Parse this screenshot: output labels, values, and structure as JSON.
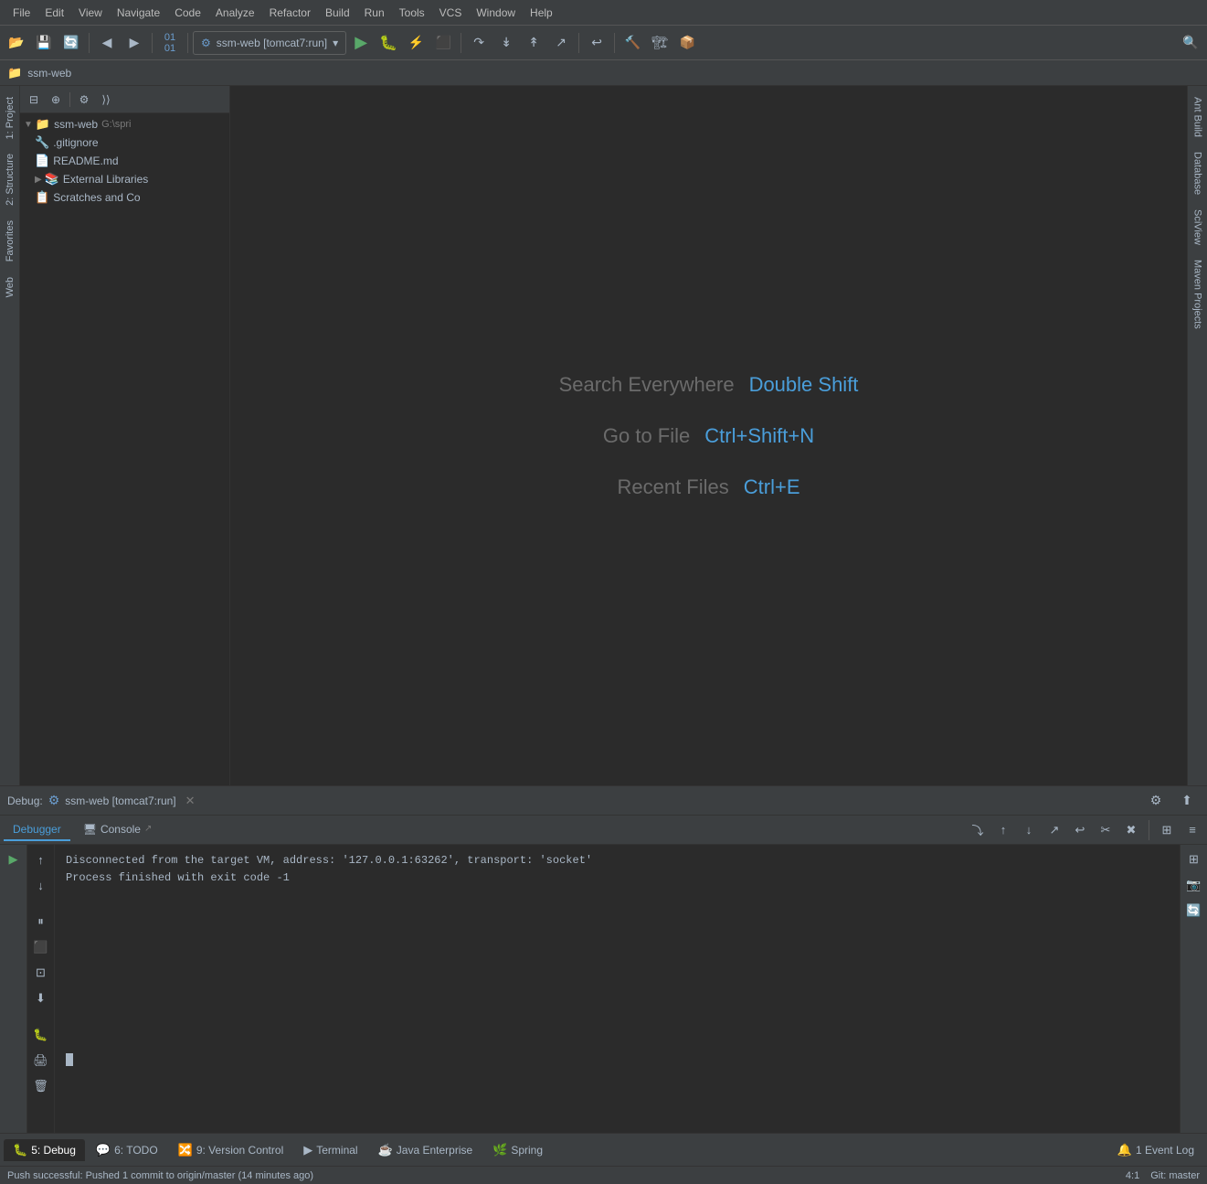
{
  "menubar": {
    "items": [
      "File",
      "Edit",
      "View",
      "Navigate",
      "Code",
      "Analyze",
      "Refactor",
      "Build",
      "Run",
      "Tools",
      "VCS",
      "Window",
      "Help"
    ]
  },
  "toolbar": {
    "run_config": "ssm-web [tomcat7:run]",
    "run_config_icon": "⚙"
  },
  "project_header": {
    "name": "ssm-web"
  },
  "project_panel": {
    "title": "1: Project",
    "tree": [
      {
        "label": "ssm-web",
        "suffix": "G:\\spri",
        "level": 0,
        "type": "folder",
        "expanded": true
      },
      {
        "label": ".gitignore",
        "level": 1,
        "type": "git"
      },
      {
        "label": "README.md",
        "level": 1,
        "type": "md"
      },
      {
        "label": "External Libraries",
        "level": 1,
        "type": "lib",
        "expandable": true
      },
      {
        "label": "Scratches and Co",
        "level": 1,
        "type": "scratch"
      }
    ]
  },
  "editor": {
    "shortcuts": [
      {
        "label": "Search Everywhere",
        "key": "Double Shift"
      },
      {
        "label": "Go to File",
        "key": "Ctrl+Shift+N"
      },
      {
        "label": "Recent Files",
        "key": "Ctrl+E"
      }
    ]
  },
  "right_sidebar": {
    "panels": [
      "Ant Build",
      "Database",
      "SciView",
      "Maven Projects"
    ]
  },
  "debug_panel": {
    "title": "Debug:",
    "run_config": "ssm-web [tomcat7:run]",
    "tabs": [
      {
        "label": "Debugger",
        "active": false
      },
      {
        "label": "Console",
        "active": true
      }
    ],
    "console_lines": [
      "Disconnected from the target VM, address: '127.0.0.1:63262', transport: 'socket'",
      "",
      "Process finished with exit code -1"
    ]
  },
  "bottom_tabs": [
    {
      "label": "5: Debug",
      "icon": "🐛",
      "active": true
    },
    {
      "label": "6: TODO",
      "icon": "💬",
      "active": false
    },
    {
      "label": "9: Version Control",
      "icon": "🔀",
      "active": false
    },
    {
      "label": "Terminal",
      "icon": "▶",
      "active": false
    },
    {
      "label": "Java Enterprise",
      "icon": "☕",
      "active": false
    },
    {
      "label": "Spring",
      "icon": "🌿",
      "active": false
    },
    {
      "label": "1 Event Log",
      "icon": "🔔",
      "active": false
    }
  ],
  "status_bar": {
    "message": "Push successful: Pushed 1 commit to origin/master (14 minutes ago)",
    "position": "4:1",
    "branch": "Git: master"
  }
}
